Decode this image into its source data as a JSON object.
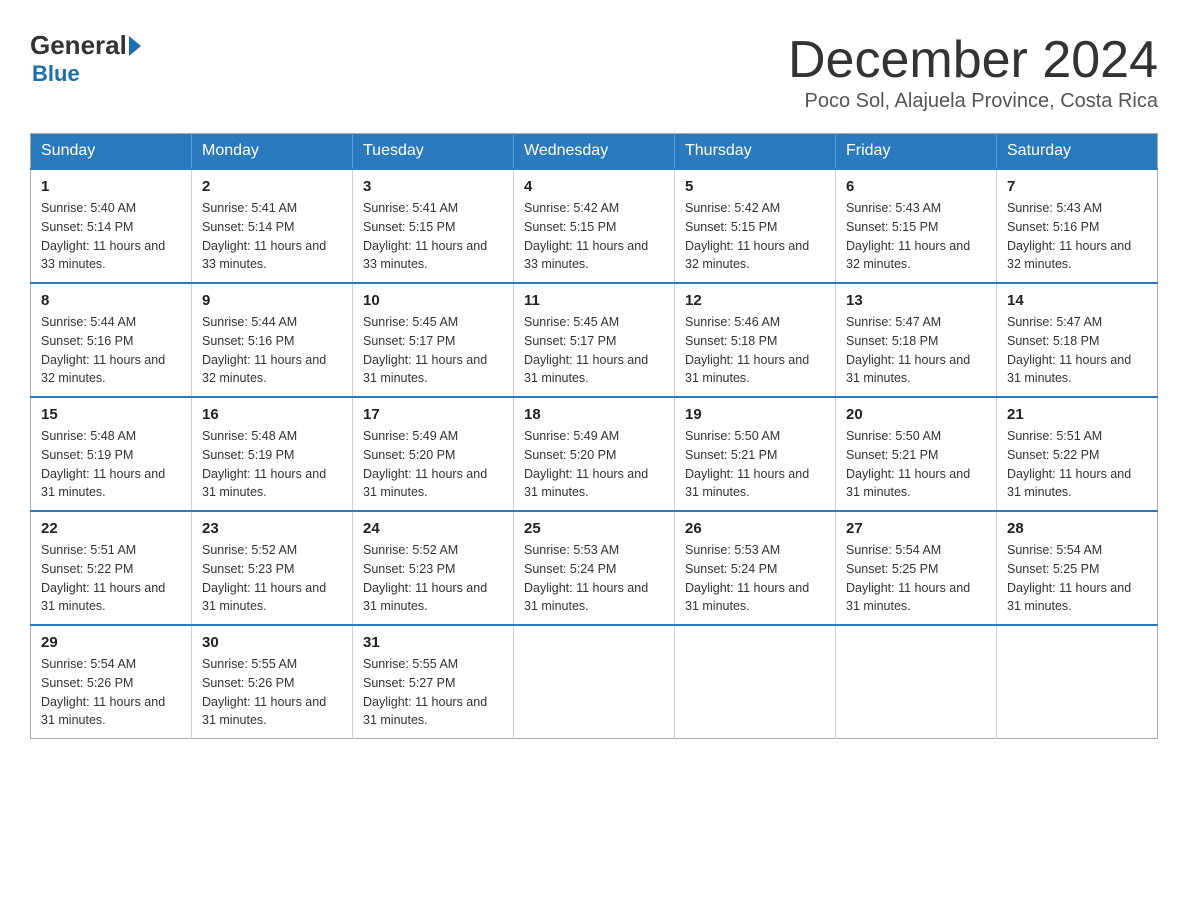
{
  "logo": {
    "general": "General",
    "blue": "Blue"
  },
  "title": "December 2024",
  "location": "Poco Sol, Alajuela Province, Costa Rica",
  "headers": [
    "Sunday",
    "Monday",
    "Tuesday",
    "Wednesday",
    "Thursday",
    "Friday",
    "Saturday"
  ],
  "weeks": [
    [
      {
        "day": "1",
        "sunrise": "5:40 AM",
        "sunset": "5:14 PM",
        "daylight": "11 hours and 33 minutes."
      },
      {
        "day": "2",
        "sunrise": "5:41 AM",
        "sunset": "5:14 PM",
        "daylight": "11 hours and 33 minutes."
      },
      {
        "day": "3",
        "sunrise": "5:41 AM",
        "sunset": "5:15 PM",
        "daylight": "11 hours and 33 minutes."
      },
      {
        "day": "4",
        "sunrise": "5:42 AM",
        "sunset": "5:15 PM",
        "daylight": "11 hours and 33 minutes."
      },
      {
        "day": "5",
        "sunrise": "5:42 AM",
        "sunset": "5:15 PM",
        "daylight": "11 hours and 32 minutes."
      },
      {
        "day": "6",
        "sunrise": "5:43 AM",
        "sunset": "5:15 PM",
        "daylight": "11 hours and 32 minutes."
      },
      {
        "day": "7",
        "sunrise": "5:43 AM",
        "sunset": "5:16 PM",
        "daylight": "11 hours and 32 minutes."
      }
    ],
    [
      {
        "day": "8",
        "sunrise": "5:44 AM",
        "sunset": "5:16 PM",
        "daylight": "11 hours and 32 minutes."
      },
      {
        "day": "9",
        "sunrise": "5:44 AM",
        "sunset": "5:16 PM",
        "daylight": "11 hours and 32 minutes."
      },
      {
        "day": "10",
        "sunrise": "5:45 AM",
        "sunset": "5:17 PM",
        "daylight": "11 hours and 31 minutes."
      },
      {
        "day": "11",
        "sunrise": "5:45 AM",
        "sunset": "5:17 PM",
        "daylight": "11 hours and 31 minutes."
      },
      {
        "day": "12",
        "sunrise": "5:46 AM",
        "sunset": "5:18 PM",
        "daylight": "11 hours and 31 minutes."
      },
      {
        "day": "13",
        "sunrise": "5:47 AM",
        "sunset": "5:18 PM",
        "daylight": "11 hours and 31 minutes."
      },
      {
        "day": "14",
        "sunrise": "5:47 AM",
        "sunset": "5:18 PM",
        "daylight": "11 hours and 31 minutes."
      }
    ],
    [
      {
        "day": "15",
        "sunrise": "5:48 AM",
        "sunset": "5:19 PM",
        "daylight": "11 hours and 31 minutes."
      },
      {
        "day": "16",
        "sunrise": "5:48 AM",
        "sunset": "5:19 PM",
        "daylight": "11 hours and 31 minutes."
      },
      {
        "day": "17",
        "sunrise": "5:49 AM",
        "sunset": "5:20 PM",
        "daylight": "11 hours and 31 minutes."
      },
      {
        "day": "18",
        "sunrise": "5:49 AM",
        "sunset": "5:20 PM",
        "daylight": "11 hours and 31 minutes."
      },
      {
        "day": "19",
        "sunrise": "5:50 AM",
        "sunset": "5:21 PM",
        "daylight": "11 hours and 31 minutes."
      },
      {
        "day": "20",
        "sunrise": "5:50 AM",
        "sunset": "5:21 PM",
        "daylight": "11 hours and 31 minutes."
      },
      {
        "day": "21",
        "sunrise": "5:51 AM",
        "sunset": "5:22 PM",
        "daylight": "11 hours and 31 minutes."
      }
    ],
    [
      {
        "day": "22",
        "sunrise": "5:51 AM",
        "sunset": "5:22 PM",
        "daylight": "11 hours and 31 minutes."
      },
      {
        "day": "23",
        "sunrise": "5:52 AM",
        "sunset": "5:23 PM",
        "daylight": "11 hours and 31 minutes."
      },
      {
        "day": "24",
        "sunrise": "5:52 AM",
        "sunset": "5:23 PM",
        "daylight": "11 hours and 31 minutes."
      },
      {
        "day": "25",
        "sunrise": "5:53 AM",
        "sunset": "5:24 PM",
        "daylight": "11 hours and 31 minutes."
      },
      {
        "day": "26",
        "sunrise": "5:53 AM",
        "sunset": "5:24 PM",
        "daylight": "11 hours and 31 minutes."
      },
      {
        "day": "27",
        "sunrise": "5:54 AM",
        "sunset": "5:25 PM",
        "daylight": "11 hours and 31 minutes."
      },
      {
        "day": "28",
        "sunrise": "5:54 AM",
        "sunset": "5:25 PM",
        "daylight": "11 hours and 31 minutes."
      }
    ],
    [
      {
        "day": "29",
        "sunrise": "5:54 AM",
        "sunset": "5:26 PM",
        "daylight": "11 hours and 31 minutes."
      },
      {
        "day": "30",
        "sunrise": "5:55 AM",
        "sunset": "5:26 PM",
        "daylight": "11 hours and 31 minutes."
      },
      {
        "day": "31",
        "sunrise": "5:55 AM",
        "sunset": "5:27 PM",
        "daylight": "11 hours and 31 minutes."
      },
      null,
      null,
      null,
      null
    ]
  ]
}
